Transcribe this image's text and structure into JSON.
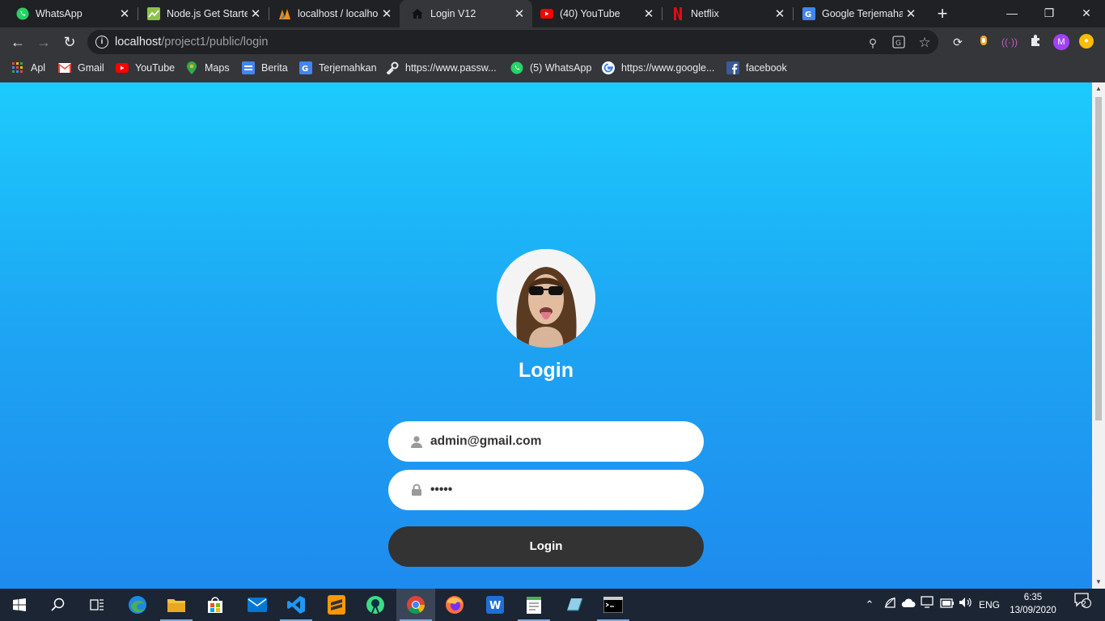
{
  "browser": {
    "tabs": [
      {
        "title": "WhatsApp",
        "icon": "whatsapp-icon",
        "active": false
      },
      {
        "title": "Node.js Get Started",
        "icon": "chart-icon",
        "active": false
      },
      {
        "title": "localhost / localhost",
        "icon": "phpmyadmin-icon",
        "active": false
      },
      {
        "title": "Login V12",
        "icon": "home-icon",
        "active": true
      },
      {
        "title": "(40) YouTube",
        "icon": "youtube-icon",
        "active": false
      },
      {
        "title": "Netflix",
        "icon": "netflix-icon",
        "active": false
      },
      {
        "title": "Google Terjemahan",
        "icon": "translate-icon",
        "active": false
      }
    ],
    "new_tab_label": "+",
    "address": {
      "host": "localhost",
      "path": "/project1/public/login"
    },
    "profile_initial": "M",
    "bookmarks": [
      {
        "label": "Apl",
        "icon": "apps-grid-icon"
      },
      {
        "label": "Gmail",
        "icon": "gmail-icon"
      },
      {
        "label": "YouTube",
        "icon": "youtube-icon"
      },
      {
        "label": "Maps",
        "icon": "maps-pin-icon"
      },
      {
        "label": "Berita",
        "icon": "news-icon"
      },
      {
        "label": "Terjemahkan",
        "icon": "translate-icon"
      },
      {
        "label": "https://www.passw...",
        "icon": "key-icon"
      },
      {
        "label": "(5) WhatsApp",
        "icon": "whatsapp-icon"
      },
      {
        "label": "https://www.google...",
        "icon": "google-icon"
      },
      {
        "label": "facebook",
        "icon": "facebook-icon"
      }
    ]
  },
  "login": {
    "heading": "Login",
    "email_value": "admin@gmail.com",
    "password_value": "•••••",
    "submit_label": "Login"
  },
  "taskbar": {
    "apps": [
      "windows-start-icon",
      "search-icon",
      "task-view-icon",
      "edge-icon",
      "file-explorer-icon",
      "store-icon",
      "mail-icon",
      "vscode-icon",
      "sublime-icon",
      "android-studio-icon",
      "chrome-icon",
      "firefox-icon",
      "wps-icon",
      "notepad-icon",
      "app-icon",
      "terminal-icon"
    ],
    "language": "ENG",
    "time": "6:35",
    "date": "13/09/2020",
    "notification_count": "2"
  },
  "colors": {
    "page_gradient_top": "#1ccbfd",
    "page_gradient_bottom": "#1e8bee",
    "button": "#333333",
    "browser_dark": "#202124",
    "toolbar": "#35363a"
  }
}
